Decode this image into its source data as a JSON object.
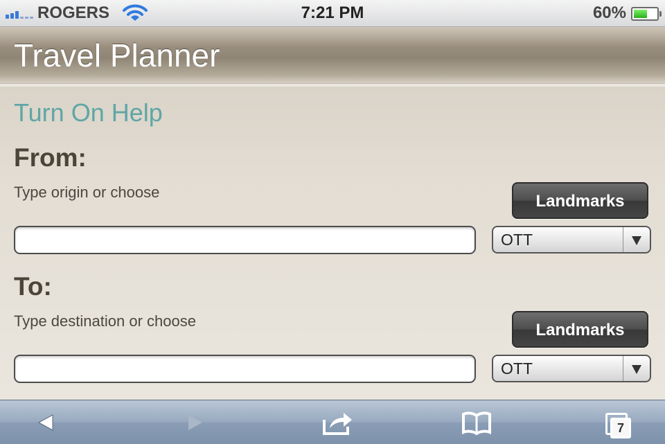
{
  "status_bar": {
    "carrier": "ROGERS",
    "time": "7:21 PM",
    "battery_percent": "60%",
    "battery_level": 0.6,
    "wifi_icon": "wifi-icon",
    "signal_icon": "signal-bars-icon"
  },
  "header": {
    "title": "Travel Planner"
  },
  "main": {
    "help_link": "Turn On Help",
    "from": {
      "label": "From:",
      "hint": "Type origin or choose",
      "landmarks_button": "Landmarks",
      "input_value": "",
      "select_value": "OTT"
    },
    "to": {
      "label": "To:",
      "hint": "Type destination or choose",
      "landmarks_button": "Landmarks",
      "input_value": "",
      "select_value": "OTT"
    }
  },
  "toolbar": {
    "back_icon": "back-arrow-icon",
    "forward_icon": "forward-arrow-icon",
    "share_icon": "share-icon",
    "bookmarks_icon": "bookmarks-icon",
    "tabs_icon": "tabs-icon",
    "tabs_count": "7"
  },
  "colors": {
    "help_link": "#5fa6a5",
    "heading": "#4b4438",
    "header_bg": "#8f8574",
    "toolbar_bg": "#8a9db5"
  }
}
